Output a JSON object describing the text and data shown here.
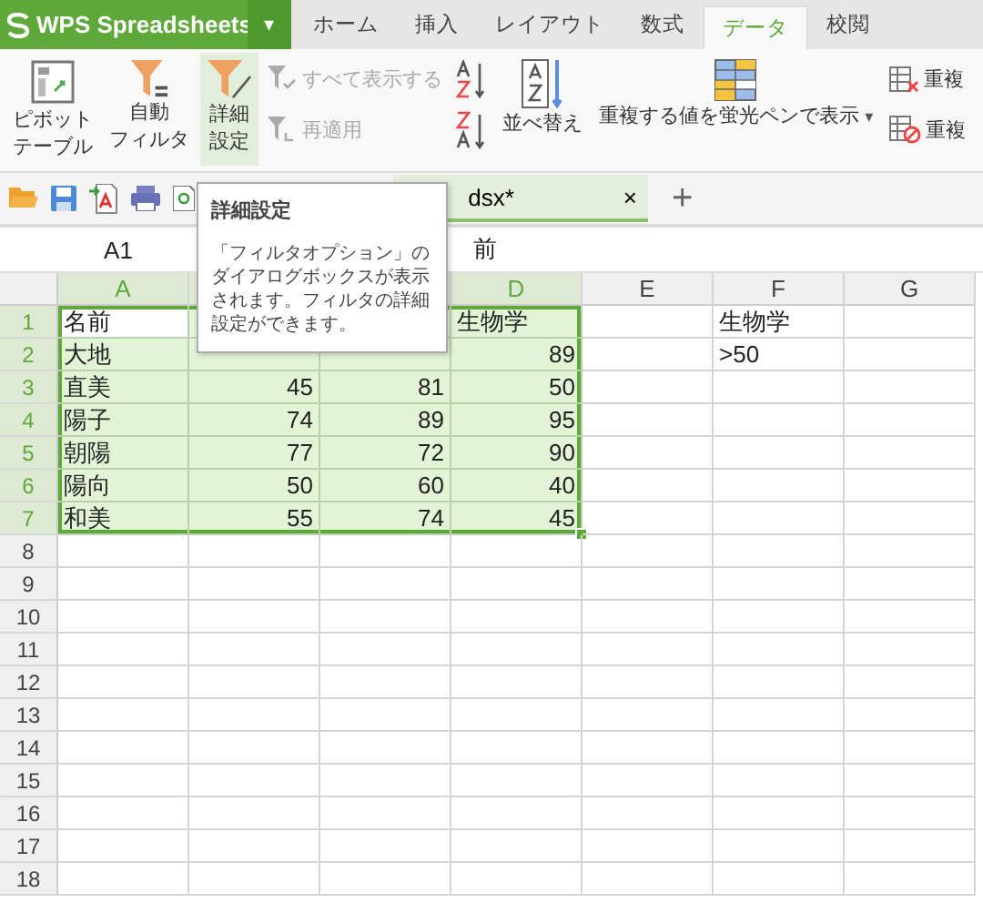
{
  "app": {
    "title": "WPS Spreadsheets",
    "menu_caret": "▾"
  },
  "tabs": [
    {
      "label": "ホーム",
      "selected": false
    },
    {
      "label": "挿入",
      "selected": false
    },
    {
      "label": "レイアウト",
      "selected": false
    },
    {
      "label": "数式",
      "selected": false
    },
    {
      "label": "データ",
      "selected": true
    },
    {
      "label": "校閲",
      "selected": false
    }
  ],
  "ribbon": [
    {
      "kind": "large",
      "lines": [
        "ピボット",
        "テーブル"
      ],
      "hovered": false
    },
    {
      "kind": "large",
      "lines": [
        "自動",
        "フィルタ"
      ],
      "hovered": false
    },
    {
      "kind": "large",
      "lines": [
        "詳細",
        "設定"
      ],
      "hovered": true
    },
    {
      "kind": "stack",
      "items": [
        {
          "label": "すべて表示する",
          "disabled": true
        },
        {
          "label": "再適用",
          "disabled": true
        }
      ]
    },
    {
      "kind": "stack",
      "items": [
        {
          "disabled": false
        },
        {
          "disabled": false
        }
      ]
    },
    {
      "kind": "large",
      "lines": [
        "並べ替え"
      ],
      "hovered": false
    },
    {
      "kind": "large",
      "lines": [
        "重複する値を蛍光ペンで表示"
      ],
      "caret": "▾",
      "hovered": false
    },
    {
      "kind": "stack",
      "items": [
        {
          "label": "重複",
          "disabled": false
        },
        {
          "label": "重複",
          "disabled": false
        }
      ]
    }
  ],
  "document_tab": {
    "title": "dsx*",
    "close": "×",
    "selected": true
  },
  "new_tab": "+",
  "name_box": "A1",
  "formula": "前",
  "columns": [
    {
      "label": "A",
      "selected": true
    },
    {},
    {},
    {
      "label": "D",
      "selected": true
    },
    {
      "label": "E",
      "selected": false
    },
    {
      "label": "F",
      "selected": false
    },
    {
      "label": "G",
      "selected": false
    }
  ],
  "rows": [
    {
      "label": "1",
      "selected": true,
      "cells": [
        {
          "text": "名前",
          "kind": "text",
          "active": true
        },
        null,
        null,
        {
          "text": "生物学",
          "kind": "text"
        },
        null,
        {
          "text": "生物学",
          "kind": "text"
        },
        null
      ]
    },
    {
      "label": "2",
      "selected": true,
      "cells": [
        {
          "text": "大地",
          "kind": "text"
        },
        null,
        null,
        {
          "text": "89",
          "kind": "number"
        },
        null,
        {
          "text": ">50",
          "kind": "text"
        },
        null
      ]
    },
    {
      "label": "3",
      "selected": true,
      "cells": [
        {
          "text": "直美",
          "kind": "text"
        },
        {
          "text": "45",
          "kind": "number"
        },
        {
          "text": "81",
          "kind": "number"
        },
        {
          "text": "50",
          "kind": "number"
        },
        null,
        null,
        null
      ]
    },
    {
      "label": "4",
      "selected": true,
      "cells": [
        {
          "text": "陽子",
          "kind": "text"
        },
        {
          "text": "74",
          "kind": "number"
        },
        {
          "text": "89",
          "kind": "number"
        },
        {
          "text": "95",
          "kind": "number"
        },
        null,
        null,
        null
      ]
    },
    {
      "label": "5",
      "selected": true,
      "cells": [
        {
          "text": "朝陽",
          "kind": "text"
        },
        {
          "text": "77",
          "kind": "number"
        },
        {
          "text": "72",
          "kind": "number"
        },
        {
          "text": "90",
          "kind": "number"
        },
        null,
        null,
        null
      ]
    },
    {
      "label": "6",
      "selected": true,
      "cells": [
        {
          "text": "陽向",
          "kind": "text"
        },
        {
          "text": "50",
          "kind": "number"
        },
        {
          "text": "60",
          "kind": "number"
        },
        {
          "text": "40",
          "kind": "number"
        },
        null,
        null,
        null
      ]
    },
    {
      "label": "7",
      "selected": true,
      "cells": [
        {
          "text": "和美",
          "kind": "text"
        },
        {
          "text": "55",
          "kind": "number"
        },
        {
          "text": "74",
          "kind": "number"
        },
        {
          "text": "45",
          "kind": "number"
        },
        null,
        null,
        null
      ]
    },
    {
      "label": "8",
      "selected": false,
      "cells": []
    },
    {
      "label": "9",
      "selected": false,
      "cells": []
    },
    {
      "label": "10",
      "selected": false,
      "cells": []
    },
    {
      "label": "11",
      "selected": false,
      "cells": []
    },
    {
      "label": "12",
      "selected": false,
      "cells": []
    },
    {
      "label": "13",
      "selected": false,
      "cells": []
    },
    {
      "label": "14",
      "selected": false,
      "cells": []
    },
    {
      "label": "15",
      "selected": false,
      "cells": []
    },
    {
      "label": "16",
      "selected": false,
      "cells": []
    },
    {
      "label": "17",
      "selected": false,
      "cells": []
    },
    {
      "label": "18",
      "selected": false,
      "cells": []
    }
  ],
  "tooltip": {
    "title": "詳細設定",
    "text": "「フィルタオプション」のダイアログボックスが表示されます。フィルタの詳細設定ができます。"
  }
}
